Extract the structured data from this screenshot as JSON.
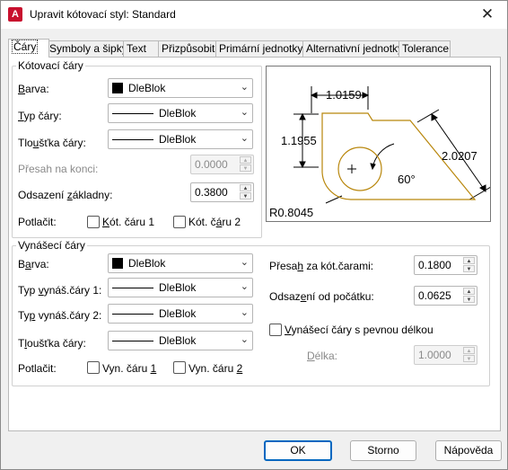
{
  "title": "Upravit kótovací styl: Standard",
  "tabs": [
    "Čáry",
    "Symboly a šipky",
    "Text",
    "Přizpůsobit",
    "Primární jednotky",
    "Alternativní jednotky",
    "Tolerance"
  ],
  "dimension_lines": {
    "group_title": "Kótovací čáry",
    "color_label": "Barva:",
    "color_value": "DleBlok",
    "linetype_label": "Typ čáry:",
    "linetype_value": "DleBlok",
    "lineweight_label": "Tloušťka čáry:",
    "lineweight_value": "DleBlok",
    "extend_label": "Přesah na konci:",
    "extend_value": "0.0000",
    "baseline_label": "Odsazení základny:",
    "baseline_value": "0.3800",
    "suppress_label": "Potlačit:",
    "suppress1": "Kót. čáru 1",
    "suppress2": "Kót. čáru 2"
  },
  "extension_lines": {
    "group_title": "Vynášecí čáry",
    "color_label": "Barva:",
    "color_value": "DleBlok",
    "linetype1_label": "Typ vynáš.čáry 1:",
    "linetype1_value": "DleBlok",
    "linetype2_label": "Typ vynáš.čáry 2:",
    "linetype2_value": "DleBlok",
    "lineweight_label": "Tloušťka čáry:",
    "lineweight_value": "DleBlok",
    "suppress_label": "Potlačit:",
    "suppress1": "Vyn. čáru 1",
    "suppress2": "Vyn. čáru 2",
    "extend_label": "Přesah za kót.čarami:",
    "extend_value": "0.1800",
    "offset_label": "Odsazení od počátku:",
    "offset_value": "0.0625",
    "fixed_label": "Vynášecí čáry s pevnou délkou",
    "length_label": "Délka:",
    "length_value": "1.0000"
  },
  "preview": {
    "dim_top": "1.0159",
    "dim_left": "1.1955",
    "dim_right": "2.0207",
    "angle": "60°",
    "radius": "R0.8045"
  },
  "buttons": {
    "ok": "OK",
    "cancel": "Storno",
    "help": "Nápověda"
  },
  "colors": {
    "accent": "#0067c0",
    "shape": "#b8860b"
  },
  "icons": {
    "app": "autocad-icon",
    "close": "close-icon"
  }
}
